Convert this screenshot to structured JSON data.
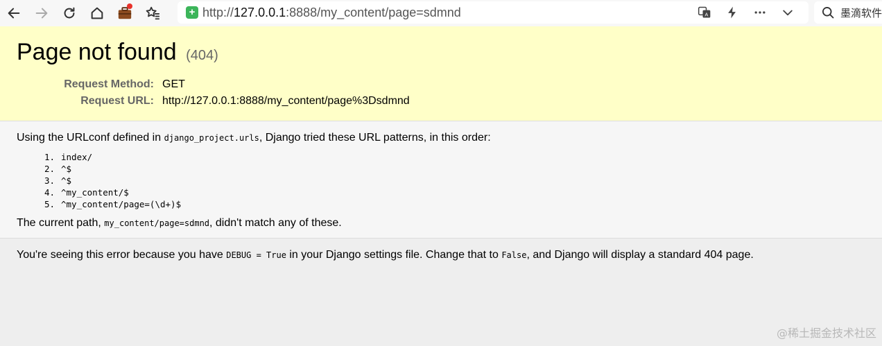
{
  "browser": {
    "url_scheme": "http://",
    "url_host": "127.0.0.1",
    "url_rest": ":8888/my_content/page=sdmnd",
    "search_placeholder": "墨滴软件",
    "icons": [
      "back-icon",
      "forward-icon",
      "reload-icon",
      "home-icon",
      "briefcase-icon",
      "bookmark-star-icon",
      "secure-icon",
      "translate-icon",
      "lightning-icon",
      "more-icon",
      "chevron-down-icon",
      "search-icon"
    ]
  },
  "summary": {
    "title": "Page not found",
    "status_code": "(404)",
    "request_method_label": "Request Method:",
    "request_method": "GET",
    "request_url_label": "Request URL:",
    "request_url": "http://127.0.0.1:8888/my_content/page%3Dsdmnd"
  },
  "info": {
    "intro_prefix": "Using the URLconf defined in ",
    "urlconf": "django_project.urls",
    "intro_suffix": ", Django tried these URL patterns, in this order:",
    "patterns": [
      {
        "num": "1.",
        "pattern": "index/"
      },
      {
        "num": "2.",
        "pattern": "^$"
      },
      {
        "num": "3.",
        "pattern": "^$"
      },
      {
        "num": "4.",
        "pattern": "^my_content/$"
      },
      {
        "num": "5.",
        "pattern": "^my_content/page=(\\d+)$"
      }
    ],
    "current_prefix": "The current path, ",
    "current_path": "my_content/page=sdmnd",
    "current_suffix": ", didn't match any of these."
  },
  "explanation": {
    "part1": "You're seeing this error because you have ",
    "debug_setting": "DEBUG = True",
    "part2": " in your Django settings file. Change that to ",
    "false_value": "False",
    "part3": ", and Django will display a standard 404 page."
  },
  "watermark": "@稀土掘金技术社区",
  "colors": {
    "summary_bg": "#ffffc8",
    "info_bg": "#f6f6f6",
    "explanation_bg": "#eeeeee",
    "secure_green": "#3cb55a",
    "notification_red": "#e8312a"
  }
}
